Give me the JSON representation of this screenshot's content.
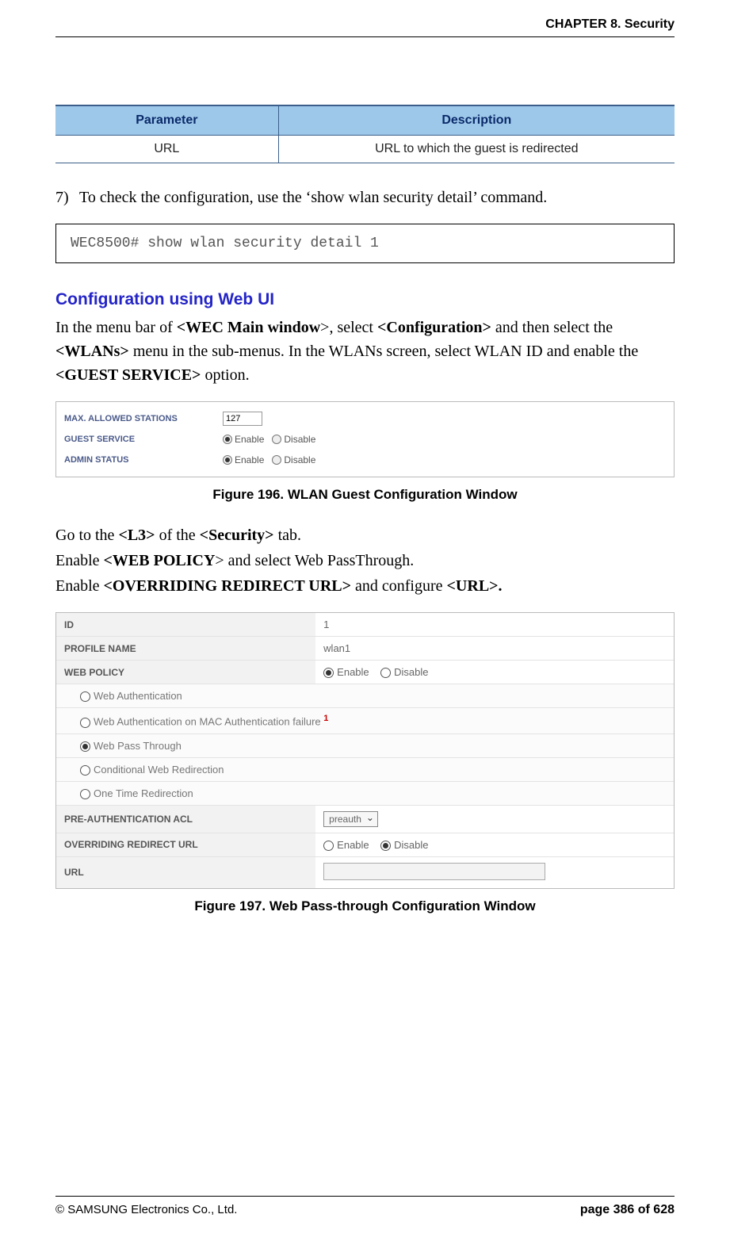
{
  "header": {
    "chapter": "CHAPTER 8. Security"
  },
  "param_table": {
    "head_param": "Parameter",
    "head_desc": "Description",
    "row_param": "URL",
    "row_desc": "URL to which the guest is redirected"
  },
  "step7": {
    "num": "7)",
    "text": "To check the configuration, use the ‘show wlan security detail’ command."
  },
  "code": "WEC8500# show wlan security detail 1",
  "section_title": "Configuration using Web UI",
  "para1_pre": "In the menu bar of ",
  "para1_b1": "<WEC Main window",
  "para1_m1": ">, select ",
  "para1_b2": "<Configuration>",
  "para1_m2": " and then select the ",
  "para1_b3": "<WLANs>",
  "para1_m3": " menu in the sub-menus. In the WLANs screen, select WLAN ID and enable the ",
  "para1_b4": "<GUEST SERVICE>",
  "para1_m4": " option.",
  "fig196": {
    "max_stations_lbl": "MAX. ALLOWED STATIONS",
    "max_stations_val": "127",
    "guest_lbl": "GUEST SERVICE",
    "admin_lbl": "ADMIN STATUS",
    "enable": "Enable",
    "disable": "Disable",
    "caption": "Figure 196. WLAN Guest Configuration Window"
  },
  "para2_pre": "Go to the ",
  "para2_b1": "<L3>",
  "para2_m1": " of the ",
  "para2_b2": "<Security>",
  "para2_m2": " tab.",
  "para3_pre": "Enable ",
  "para3_b1": "<WEB POLICY",
  "para3_m1": "> and select Web PassThrough.",
  "para4_pre": "Enable ",
  "para4_b1": "<OVERRIDING REDIRECT URL>",
  "para4_m1": " and configure ",
  "para4_b2": "<URL>.",
  "fig197": {
    "id_lbl": "ID",
    "id_val": "1",
    "profile_lbl": "PROFILE NAME",
    "profile_val": "wlan1",
    "webpolicy_lbl": "WEB POLICY",
    "enable": "Enable",
    "disable": "Disable",
    "opt_webauth": "Web Authentication",
    "opt_macfail": "Web Authentication on MAC Authentication failure",
    "opt_macfail_sup": "1",
    "opt_passthrough": "Web Pass Through",
    "opt_conditional": "Conditional Web Redirection",
    "opt_onetime": "One Time Redirection",
    "preauth_lbl": "PRE-AUTHENTICATION ACL",
    "preauth_val": "preauth",
    "override_lbl": "OVERRIDING REDIRECT URL",
    "url_lbl": "URL",
    "caption": "Figure 197. Web Pass-through Configuration Window"
  },
  "footer": {
    "copyright": "© SAMSUNG Electronics Co., Ltd.",
    "page": "page 386 of 628"
  }
}
